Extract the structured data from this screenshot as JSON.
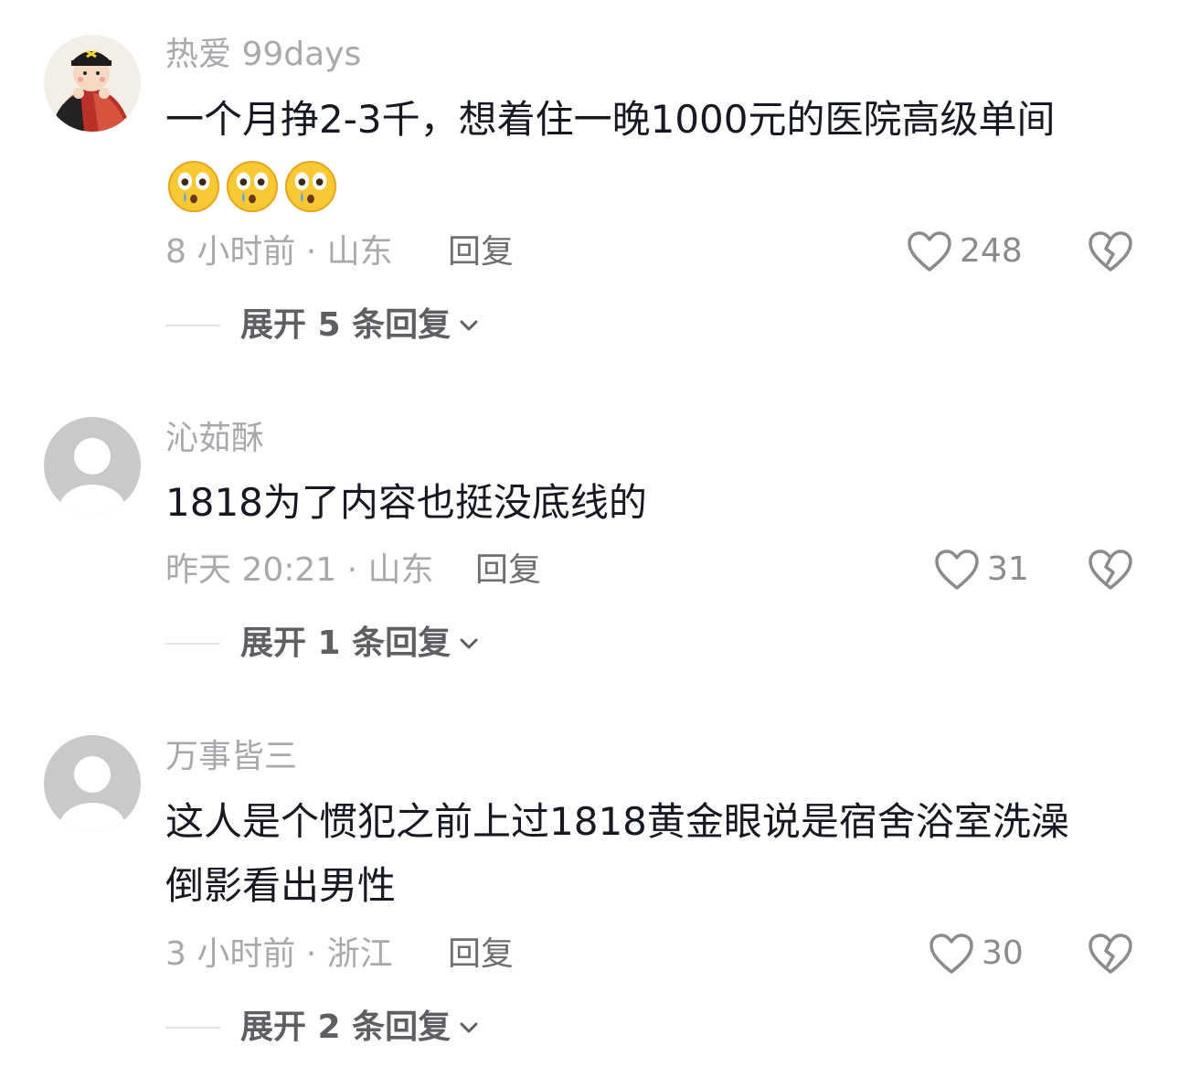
{
  "comments": [
    {
      "username": "热爱 99days",
      "text_lines": [
        "一个月挣2-3千，想着住一晚1000元的医院高级单间"
      ],
      "emojis": [
        "crying-face-emoji",
        "crying-face-emoji",
        "crying-face-emoji"
      ],
      "time_location": "8 小时前 · 山东",
      "reply_label": "回复",
      "likes": "248",
      "expand_label": "展开 5 条回复"
    },
    {
      "username": "沁茹酥",
      "text_lines": [
        "1818为了内容也挺没底线的"
      ],
      "time_location": "昨天 20:21 · 山东",
      "reply_label": "回复",
      "likes": "31",
      "expand_label": "展开 1 条回复"
    },
    {
      "username": "万事皆三",
      "text_lines": [
        "这人是个惯犯之前上过1818黄金眼说是宿舍浴室洗澡",
        "倒影看出男性"
      ],
      "time_location": "3 小时前 · 浙江",
      "reply_label": "回复",
      "likes": "30",
      "expand_label": "展开 2 条回复"
    }
  ],
  "colors": {
    "username": "#a8a8ad",
    "body_text": "#161823",
    "meta": "#a8a8ad",
    "reply": "#6e6e73",
    "expand": "#5e5e63",
    "default_avatar_bg": "#c9c9cc"
  },
  "icons": {
    "like": "heart-outline-icon",
    "dislike": "broken-heart-icon",
    "expand": "chevron-down-icon"
  }
}
